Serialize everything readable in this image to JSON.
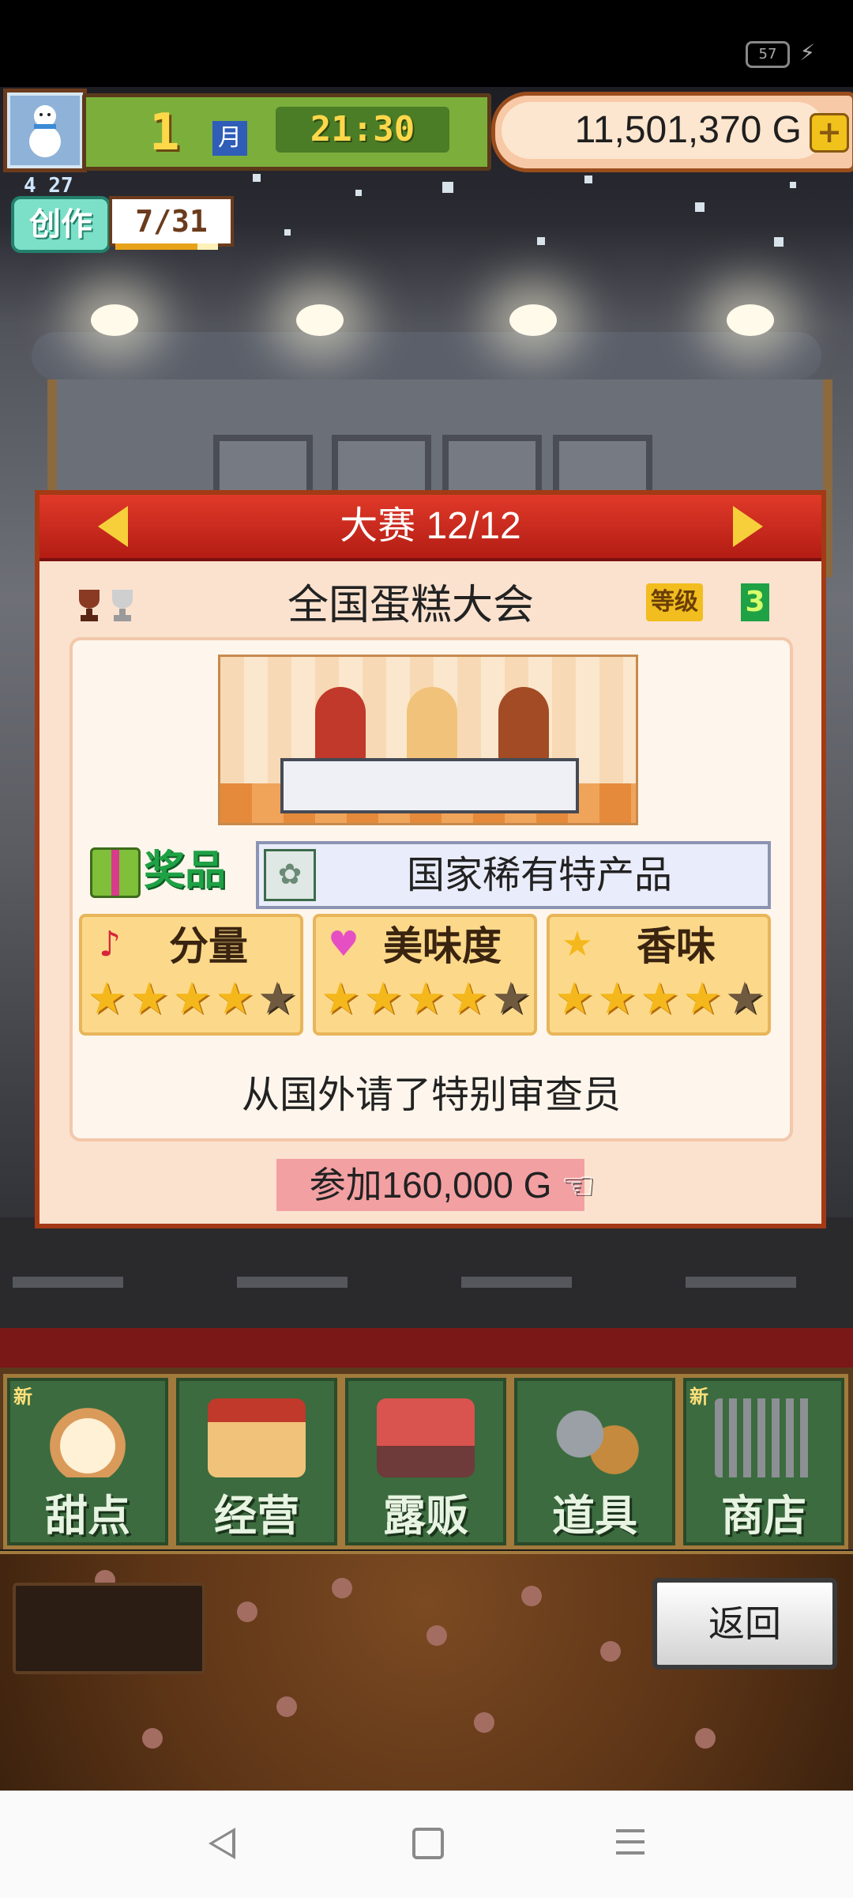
{
  "status_bar": {
    "battery": "57"
  },
  "hud": {
    "month_number": "1",
    "month_label": "月",
    "time": "21:30",
    "money": "11,501,370 G",
    "create": {
      "date": "4 27",
      "label": "创作",
      "count": "7/31",
      "progress": 0.8
    }
  },
  "contest": {
    "header_title": "大赛 12/12",
    "name": "全国蛋糕大会",
    "level_label": "等级",
    "level_value": "3",
    "prize_label": "奖品",
    "prize_value": "国家稀有特产品",
    "stats": [
      {
        "name": "分量",
        "icon": "note-icon",
        "stars": 4,
        "max": 5
      },
      {
        "name": "美味度",
        "icon": "heart-icon",
        "stars": 4,
        "max": 5
      },
      {
        "name": "香味",
        "icon": "star-icon",
        "stars": 4,
        "max": 5
      }
    ],
    "description": "从国外请了特别审查员",
    "join_label": "参加160,000 G"
  },
  "menu": {
    "items": [
      {
        "label": "甜点",
        "new": "新"
      },
      {
        "label": "经营",
        "new": ""
      },
      {
        "label": "露贩",
        "new": ""
      },
      {
        "label": "道具",
        "new": ""
      },
      {
        "label": "商店",
        "new": "新"
      }
    ]
  },
  "back_label": "返回",
  "colors": {
    "accent": "#b31c14",
    "menu_green": "#3b6b3e",
    "panel": "#fbe2cf"
  }
}
